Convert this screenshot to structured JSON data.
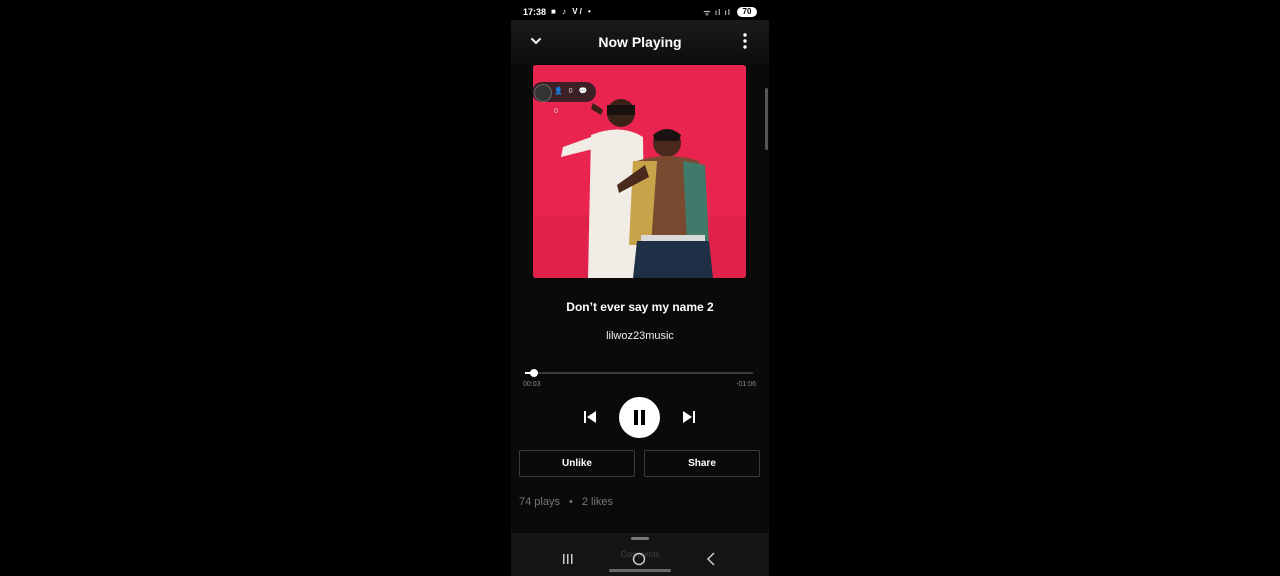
{
  "status_bar": {
    "time": "17:38",
    "battery": "70",
    "left_icons": "■ ♪ V/ •",
    "right_icons": "ᯤ ıl ıl"
  },
  "header": {
    "title": "Now Playing"
  },
  "overlay": {
    "counts": "👤 0 💬 0"
  },
  "track": {
    "title": "Don’t ever say my name 2",
    "artist": "lilwoz23music"
  },
  "player": {
    "elapsed": "00:03",
    "remaining": "-01:06",
    "progress": 0.04,
    "state": "playing"
  },
  "actions": {
    "unlike_label": "Unlike",
    "share_label": "Share"
  },
  "stats": {
    "plays": "74 plays",
    "separator": "•",
    "likes": "2 likes"
  },
  "sheet": {
    "label": "Comments"
  },
  "colors": {
    "accent": "#ffffff",
    "artwork_bg": "#e8244f",
    "background": "#0a0a0a"
  }
}
